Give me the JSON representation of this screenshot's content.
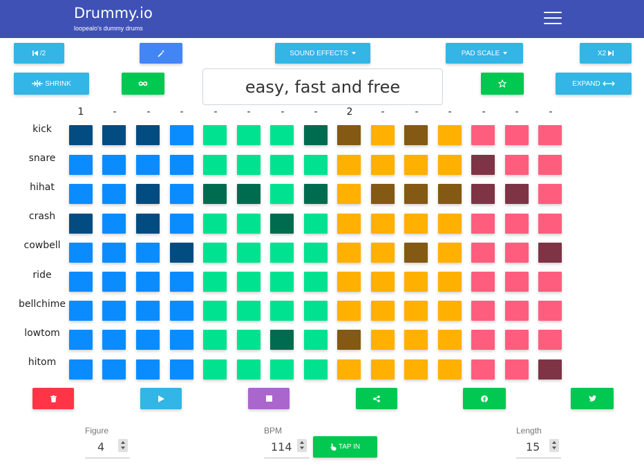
{
  "brand": {
    "title": "Drummy.io",
    "subtitle": "loopealo's dummy drums"
  },
  "toolbar": {
    "half_label": "/2",
    "sound_effects_label": "SOUND EFFECTS",
    "pad_scale_label": "PAD SCALE",
    "double_label": "X2",
    "shrink_label": "SHRINK",
    "expand_label": "EXPAND"
  },
  "tagline": "easy, fast and free",
  "beat_markers": [
    "1",
    "-",
    "-",
    "-",
    "-",
    "-",
    "-",
    "-",
    "2",
    "-",
    "-",
    "-",
    "-",
    "-",
    "-"
  ],
  "instruments": [
    "kick",
    "snare",
    "hihat",
    "crash",
    "cowbell",
    "ride",
    "bellchime",
    "lowtom",
    "hitom"
  ],
  "palette": {
    "blue": {
      "off": "#0a8cff",
      "on": "#034c82"
    },
    "green": {
      "off": "#00e28f",
      "on": "#006c4f"
    },
    "orange": {
      "off": "#ffb000",
      "on": "#835913"
    },
    "pink": {
      "off": "#ff5d7e",
      "on": "#7f3446"
    },
    "brand": "#3f51b5"
  },
  "groups": [
    "blue",
    "blue",
    "blue",
    "blue",
    "green",
    "green",
    "green",
    "green",
    "orange",
    "orange",
    "orange",
    "orange",
    "pink",
    "pink",
    "pink"
  ],
  "pattern": [
    [
      1,
      1,
      1,
      0,
      0,
      0,
      0,
      1,
      1,
      0,
      1,
      0,
      0,
      0,
      0
    ],
    [
      0,
      0,
      0,
      0,
      0,
      0,
      0,
      0,
      0,
      0,
      0,
      0,
      1,
      0,
      0
    ],
    [
      0,
      0,
      1,
      0,
      1,
      1,
      0,
      1,
      0,
      1,
      1,
      1,
      1,
      1,
      0
    ],
    [
      1,
      0,
      1,
      0,
      0,
      0,
      1,
      0,
      0,
      0,
      0,
      0,
      0,
      0,
      0
    ],
    [
      0,
      0,
      0,
      1,
      0,
      0,
      0,
      0,
      0,
      0,
      1,
      0,
      0,
      0,
      1
    ],
    [
      0,
      0,
      0,
      0,
      0,
      0,
      0,
      0,
      0,
      0,
      0,
      0,
      0,
      0,
      0
    ],
    [
      0,
      0,
      0,
      0,
      0,
      0,
      0,
      0,
      0,
      0,
      0,
      0,
      0,
      0,
      0
    ],
    [
      0,
      0,
      0,
      0,
      0,
      0,
      1,
      0,
      1,
      0,
      0,
      0,
      0,
      0,
      0
    ],
    [
      0,
      0,
      0,
      0,
      0,
      0,
      0,
      0,
      0,
      0,
      0,
      0,
      0,
      0,
      1
    ]
  ],
  "controls": {
    "figure_label": "Figure",
    "figure_value": "4",
    "bpm_label": "BPM",
    "bpm_value": "114",
    "tap_in_label": "TAP IN",
    "length_label": "Length",
    "length_value": "15"
  },
  "icons": {
    "half": "skip-back-icon",
    "magic": "magic-wand-icon",
    "double": "skip-forward-icon",
    "shrink": "compress-icon",
    "loop": "infinity-icon",
    "favorite": "star-icon",
    "expand": "expand-icon",
    "delete": "trash-icon",
    "play": "play-icon",
    "stop": "stop-icon",
    "share": "share-icon",
    "facebook": "facebook-icon",
    "twitter": "twitter-icon",
    "tap": "hand-pointer-icon",
    "menu": "hamburger-icon"
  }
}
